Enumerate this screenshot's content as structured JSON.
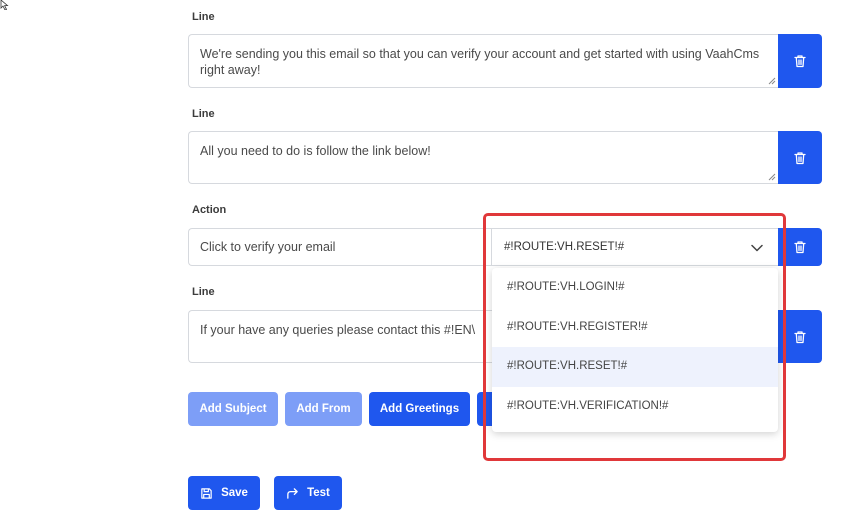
{
  "lines": [
    {
      "label": "Line",
      "value": "We're sending you this email so that you can verify your account and get started with using VaahCms right away!"
    },
    {
      "label": "Line",
      "value": "All you need to do is follow the link below!"
    }
  ],
  "action": {
    "label": "Action",
    "text_value": "Click to verify your email",
    "selected_route": "#!ROUTE:VH.RESET!#",
    "options": [
      "#!ROUTE:VH.LOGIN!#",
      "#!ROUTE:VH.REGISTER!#",
      "#!ROUTE:VH.RESET!#",
      "#!ROUTE:VH.VERIFICATION!#"
    ],
    "selected_index": 2
  },
  "last_line": {
    "label": "Line",
    "value": "If your have any queries please contact this #!EN\\"
  },
  "add_buttons": {
    "add_subject": "Add Subject",
    "add_from": "Add From",
    "add_greetings": "Add Greetings"
  },
  "footer": {
    "save": "Save",
    "test": "Test"
  },
  "colors": {
    "primary": "#1f57ee",
    "primary_light": "#7d9ef7",
    "highlight": "#e0383a",
    "selected_option_bg": "#eef2fd"
  },
  "icons": {
    "delete": "trash-icon",
    "dropdown": "chevron-down-icon",
    "save": "save-icon",
    "test": "share-arrow-icon"
  }
}
